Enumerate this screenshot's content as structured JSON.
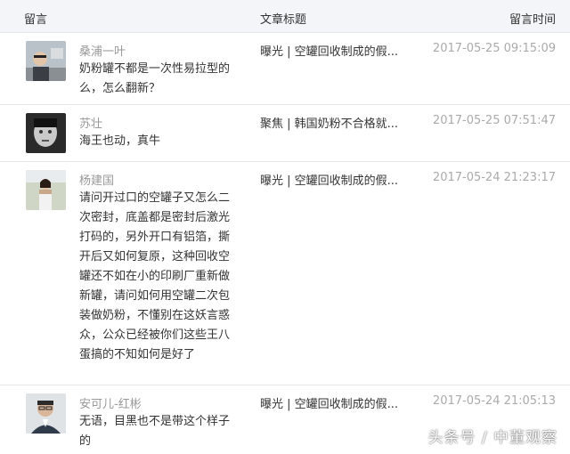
{
  "header": {
    "comment_label": "留言",
    "article_label": "文章标题",
    "time_label": "留言时间"
  },
  "comments": [
    {
      "name": "桑浦一叶",
      "content": "奶粉罐不都是一次性易拉型的么，怎么翻新？",
      "article": "曝光 | 空罐回收制成的假...",
      "time": "2017-05-25 09:15:09"
    },
    {
      "name": "苏壮",
      "content": "海王也动，真牛",
      "article": "聚焦 | 韩国奶粉不合格就...",
      "time": "2017-05-25 07:51:47"
    },
    {
      "name": "杨建国",
      "content": "请问开过口的空罐子又怎么二次密封，底盖都是密封后激光打码的，另外开口有铝箔，撕开后又如何复原，这种回收空罐还不如在小的印刷厂重新做新罐，请问如何用空罐二次包装做奶粉，不懂别在这妖言惑众，公众已经被你们这些王八蛋搞的不知如何是好了",
      "article": "曝光 | 空罐回收制成的假...",
      "time": "2017-05-24 21:23:17"
    },
    {
      "name": "安可儿-红彬",
      "content": "无语，目黑也不是带这个样子的",
      "article": "曝光 | 空罐回收制成的假...",
      "time": "2017-05-24 21:05:13"
    }
  ],
  "watermark": "头条号 / 中董观察"
}
